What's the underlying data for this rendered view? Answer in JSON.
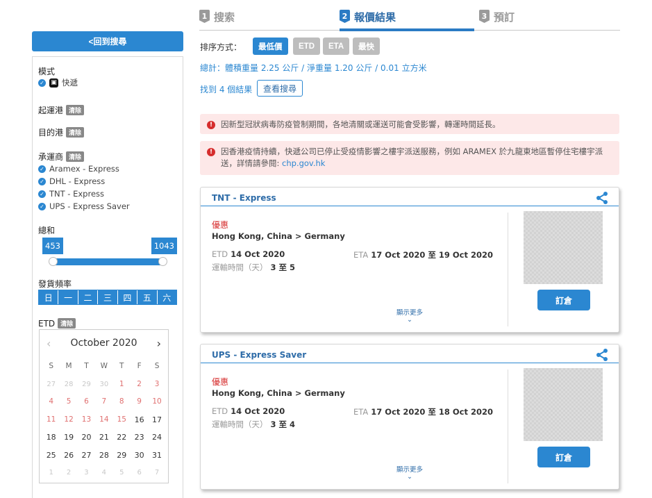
{
  "steps": [
    {
      "num": "1",
      "label": "搜索"
    },
    {
      "num": "2",
      "label": "報價結果"
    },
    {
      "num": "3",
      "label": "預訂"
    }
  ],
  "sidebar": {
    "back_label": "<回到搜尋",
    "mode_label": "模式",
    "mode_value": "快遞",
    "origin_label": "起運港",
    "dest_label": "目的港",
    "carrier_label": "承運商",
    "clear_label": "清除",
    "carriers": [
      "Aramex - Express",
      "DHL - Express",
      "TNT - Express",
      "UPS - Express Saver"
    ],
    "total_label": "總和",
    "range_min": "453",
    "range_max": "1043",
    "freq_label": "發貨頻率",
    "days": [
      "日",
      "一",
      "二",
      "三",
      "四",
      "五",
      "六"
    ],
    "etd_label": "ETD"
  },
  "calendar": {
    "month": "October 2020",
    "prev": "‹",
    "next": "›",
    "headers": [
      "S",
      "M",
      "T",
      "W",
      "T",
      "F",
      "S"
    ],
    "weeks": [
      [
        "27",
        "28",
        "29",
        "30",
        "1",
        "2",
        "3"
      ],
      [
        "4",
        "5",
        "6",
        "7",
        "8",
        "9",
        "10"
      ],
      [
        "11",
        "12",
        "13",
        "14",
        "15",
        "16",
        "17"
      ],
      [
        "18",
        "19",
        "20",
        "21",
        "22",
        "23",
        "24"
      ],
      [
        "25",
        "26",
        "27",
        "28",
        "29",
        "30",
        "31"
      ],
      [
        "1",
        "2",
        "3",
        "4",
        "5",
        "6",
        "7"
      ]
    ]
  },
  "sort": {
    "label": "排序方式：",
    "options": [
      "最低價",
      "ETD",
      "ETA",
      "最快"
    ]
  },
  "summary": {
    "totals": "總計：體積重量 2.25 公斤 / 淨重量 1.20 公斤 / 0.01 立方米",
    "found": "找到 4 個結果",
    "view_search": "查看搜尋"
  },
  "alerts": [
    {
      "text": "因新型冠狀病毒防疫管制期間，各地清關或運送可能會受影響，轉運時間延長。"
    },
    {
      "text": "因香港疫情持續，快遞公司已停止受疫情影響之樓宇派送服務，例如 ARAMEX 於九龍東地區暫停住宅樓宇派送，詳情請參閱: ",
      "link": "chp.gov.hk"
    }
  ],
  "results": [
    {
      "carrier": "TNT - Express",
      "tag": "優惠",
      "route": "Hong Kong, China > Germany",
      "etd_label": "ETD",
      "etd": "14 Oct 2020",
      "eta_label": "ETA",
      "eta": "17 Oct 2020 至 19 Oct 2020",
      "transit_label": "運輸時間（天）",
      "transit": "3 至 5",
      "more": "顯示更多",
      "book": "訂倉"
    },
    {
      "carrier": "UPS - Express Saver",
      "tag": "優惠",
      "route": "Hong Kong, China > Germany",
      "etd_label": "ETD",
      "etd": "14 Oct 2020",
      "eta_label": "ETA",
      "eta": "17 Oct 2020 至 18 Oct 2020",
      "transit_label": "運輸時間（天）",
      "transit": "3 至 4",
      "more": "顯示更多",
      "book": "訂倉"
    }
  ],
  "colors": {
    "accent": "#2b87d1",
    "alert_bg": "#fde8e8",
    "alert_icon": "#d62d2d"
  }
}
